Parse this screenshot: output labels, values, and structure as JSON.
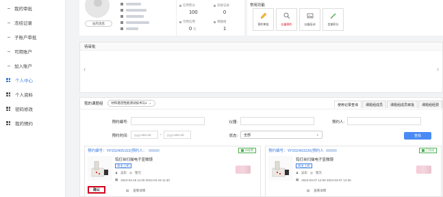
{
  "sidebar": {
    "items": [
      {
        "label": "我的审批"
      },
      {
        "label": "冻结记录"
      },
      {
        "label": "子账户审批"
      },
      {
        "label": "可用账户"
      },
      {
        "label": "加入账户"
      },
      {
        "label": "个人中心"
      },
      {
        "label": "个人资料"
      },
      {
        "label": "密码修改"
      },
      {
        "label": "我的预约"
      }
    ]
  },
  "profile": {
    "message_button": "站内消息"
  },
  "stats": [
    {
      "label": "信用积分",
      "value": "100",
      "unit": ""
    },
    {
      "label": "违规记录",
      "value": "0",
      "unit": ""
    },
    {
      "label": "可用信用",
      "value": "0",
      "unit": "元"
    },
    {
      "label": "课题组",
      "value": "1",
      "unit": ""
    }
  ],
  "common_functions": {
    "title": "常用功能",
    "tools": [
      {
        "label": "预约审批",
        "icon": "pencil-icon"
      },
      {
        "label": "仪器预约",
        "icon": "magnifier-icon"
      },
      {
        "label": "仪器培训",
        "icon": "image-icon"
      },
      {
        "label": "信誉积分",
        "icon": "pen-icon"
      }
    ]
  },
  "pending": {
    "title": "待审批"
  },
  "my_projects": {
    "title": "我的课题组",
    "selected_group": "材料基因性能测试技术与1",
    "tabs": [
      "使用记录查询",
      "课题组成员",
      "课题组成员审批",
      "课题组经费"
    ],
    "filters": {
      "booking_no_label": "预约编号:",
      "instrument_label": "仪器:",
      "booker_label": "预约人:",
      "time_label": "预约时间:",
      "date_placeholder_start": "yyyy-MM-dd",
      "date_placeholder_end": "yyyy-MM-dd",
      "date_sep": "-",
      "status_label": "状态:",
      "status_value": "全部",
      "search_label": "查找"
    },
    "cards": [
      {
        "booking_no": "预约编号：YP202405153(预约人：",
        "badge": "待收费",
        "instrument": "钨灯丝扫描电子显微镜",
        "tag": "商主上机",
        "meta_user": "吴彩",
        "meta_sub": "管元",
        "time": "2024-04-19  11:00  2024-04-19  11:30",
        "foot": "查看详情",
        "confirm": "确认"
      },
      {
        "booking_no": "预约编号：YP202403226(预约人",
        "badge": "已完成",
        "instrument": "钨灯丝扫描电子显微镜",
        "tag": "商主上机",
        "meta_user": "吴彩",
        "meta_sub": "管元",
        "time": "2024-03-07  12:00  2024-03-07  12:30",
        "foot": "查看详情"
      }
    ]
  }
}
